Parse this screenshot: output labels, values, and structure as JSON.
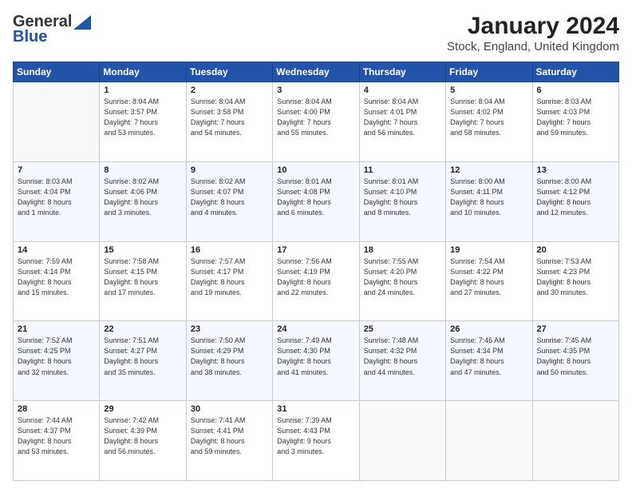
{
  "header": {
    "logo_line1": "General",
    "logo_line2": "Blue",
    "title": "January 2024",
    "subtitle": "Stock, England, United Kingdom"
  },
  "days_of_week": [
    "Sunday",
    "Monday",
    "Tuesday",
    "Wednesday",
    "Thursday",
    "Friday",
    "Saturday"
  ],
  "weeks": [
    [
      {
        "day": "",
        "info": ""
      },
      {
        "day": "1",
        "info": "Sunrise: 8:04 AM\nSunset: 3:57 PM\nDaylight: 7 hours\nand 53 minutes."
      },
      {
        "day": "2",
        "info": "Sunrise: 8:04 AM\nSunset: 3:58 PM\nDaylight: 7 hours\nand 54 minutes."
      },
      {
        "day": "3",
        "info": "Sunrise: 8:04 AM\nSunset: 4:00 PM\nDaylight: 7 hours\nand 55 minutes."
      },
      {
        "day": "4",
        "info": "Sunrise: 8:04 AM\nSunset: 4:01 PM\nDaylight: 7 hours\nand 56 minutes."
      },
      {
        "day": "5",
        "info": "Sunrise: 8:04 AM\nSunset: 4:02 PM\nDaylight: 7 hours\nand 58 minutes."
      },
      {
        "day": "6",
        "info": "Sunrise: 8:03 AM\nSunset: 4:03 PM\nDaylight: 7 hours\nand 59 minutes."
      }
    ],
    [
      {
        "day": "7",
        "info": "Sunrise: 8:03 AM\nSunset: 4:04 PM\nDaylight: 8 hours\nand 1 minute."
      },
      {
        "day": "8",
        "info": "Sunrise: 8:02 AM\nSunset: 4:06 PM\nDaylight: 8 hours\nand 3 minutes."
      },
      {
        "day": "9",
        "info": "Sunrise: 8:02 AM\nSunset: 4:07 PM\nDaylight: 8 hours\nand 4 minutes."
      },
      {
        "day": "10",
        "info": "Sunrise: 8:01 AM\nSunset: 4:08 PM\nDaylight: 8 hours\nand 6 minutes."
      },
      {
        "day": "11",
        "info": "Sunrise: 8:01 AM\nSunset: 4:10 PM\nDaylight: 8 hours\nand 8 minutes."
      },
      {
        "day": "12",
        "info": "Sunrise: 8:00 AM\nSunset: 4:11 PM\nDaylight: 8 hours\nand 10 minutes."
      },
      {
        "day": "13",
        "info": "Sunrise: 8:00 AM\nSunset: 4:12 PM\nDaylight: 8 hours\nand 12 minutes."
      }
    ],
    [
      {
        "day": "14",
        "info": "Sunrise: 7:59 AM\nSunset: 4:14 PM\nDaylight: 8 hours\nand 15 minutes."
      },
      {
        "day": "15",
        "info": "Sunrise: 7:58 AM\nSunset: 4:15 PM\nDaylight: 8 hours\nand 17 minutes."
      },
      {
        "day": "16",
        "info": "Sunrise: 7:57 AM\nSunset: 4:17 PM\nDaylight: 8 hours\nand 19 minutes."
      },
      {
        "day": "17",
        "info": "Sunrise: 7:56 AM\nSunset: 4:19 PM\nDaylight: 8 hours\nand 22 minutes."
      },
      {
        "day": "18",
        "info": "Sunrise: 7:55 AM\nSunset: 4:20 PM\nDaylight: 8 hours\nand 24 minutes."
      },
      {
        "day": "19",
        "info": "Sunrise: 7:54 AM\nSunset: 4:22 PM\nDaylight: 8 hours\nand 27 minutes."
      },
      {
        "day": "20",
        "info": "Sunrise: 7:53 AM\nSunset: 4:23 PM\nDaylight: 8 hours\nand 30 minutes."
      }
    ],
    [
      {
        "day": "21",
        "info": "Sunrise: 7:52 AM\nSunset: 4:25 PM\nDaylight: 8 hours\nand 32 minutes."
      },
      {
        "day": "22",
        "info": "Sunrise: 7:51 AM\nSunset: 4:27 PM\nDaylight: 8 hours\nand 35 minutes."
      },
      {
        "day": "23",
        "info": "Sunrise: 7:50 AM\nSunset: 4:29 PM\nDaylight: 8 hours\nand 38 minutes."
      },
      {
        "day": "24",
        "info": "Sunrise: 7:49 AM\nSunset: 4:30 PM\nDaylight: 8 hours\nand 41 minutes."
      },
      {
        "day": "25",
        "info": "Sunrise: 7:48 AM\nSunset: 4:32 PM\nDaylight: 8 hours\nand 44 minutes."
      },
      {
        "day": "26",
        "info": "Sunrise: 7:46 AM\nSunset: 4:34 PM\nDaylight: 8 hours\nand 47 minutes."
      },
      {
        "day": "27",
        "info": "Sunrise: 7:45 AM\nSunset: 4:35 PM\nDaylight: 8 hours\nand 50 minutes."
      }
    ],
    [
      {
        "day": "28",
        "info": "Sunrise: 7:44 AM\nSunset: 4:37 PM\nDaylight: 8 hours\nand 53 minutes."
      },
      {
        "day": "29",
        "info": "Sunrise: 7:42 AM\nSunset: 4:39 PM\nDaylight: 8 hours\nand 56 minutes."
      },
      {
        "day": "30",
        "info": "Sunrise: 7:41 AM\nSunset: 4:41 PM\nDaylight: 8 hours\nand 59 minutes."
      },
      {
        "day": "31",
        "info": "Sunrise: 7:39 AM\nSunset: 4:43 PM\nDaylight: 9 hours\nand 3 minutes."
      },
      {
        "day": "",
        "info": ""
      },
      {
        "day": "",
        "info": ""
      },
      {
        "day": "",
        "info": ""
      }
    ]
  ]
}
